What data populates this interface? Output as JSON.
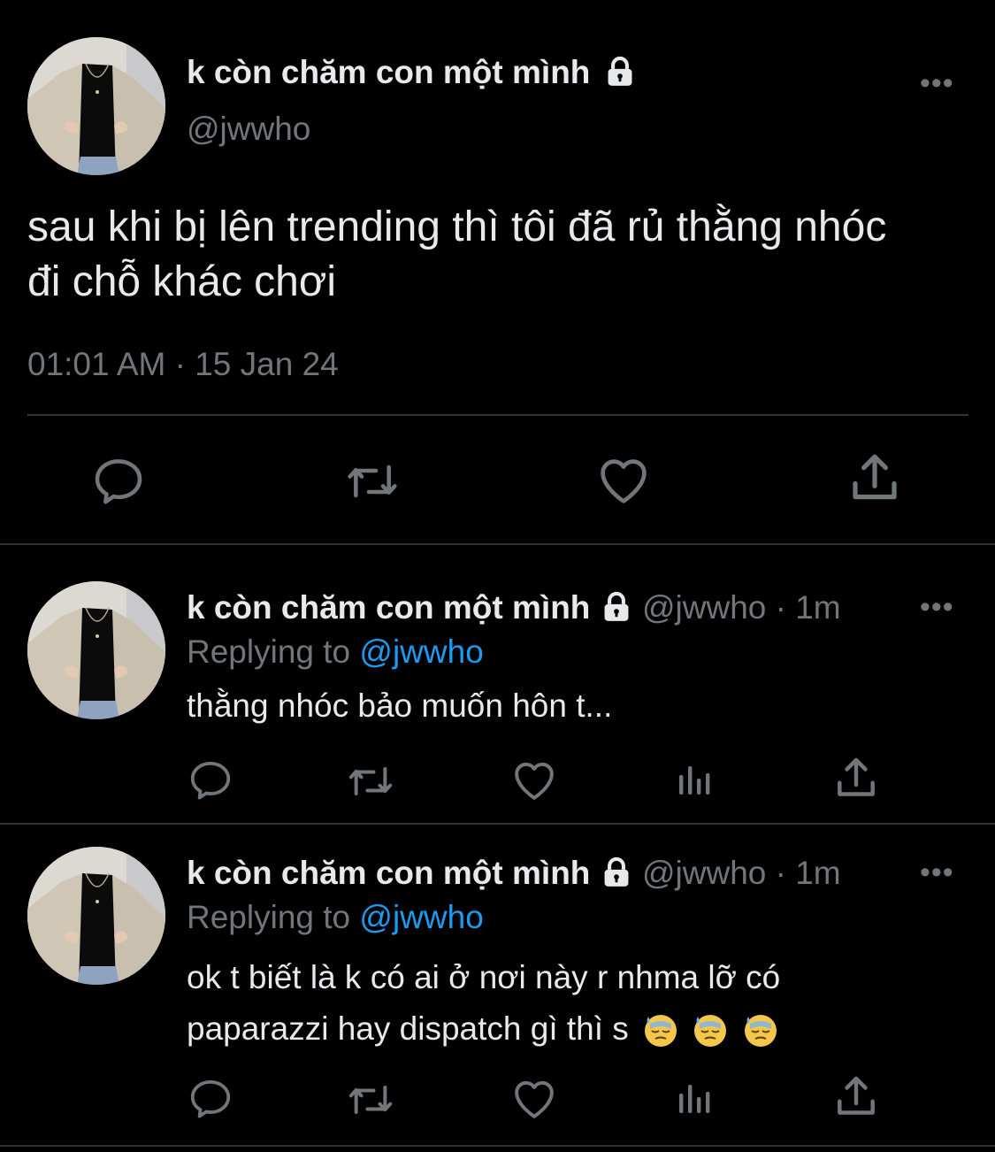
{
  "main_tweet": {
    "display_name": "k còn chăm con một mình",
    "handle": "@jwwho",
    "text_line1": "sau khi bị lên trending thì tôi đã rủ thằng nhóc",
    "text_line2": "đi chỗ khác chơi",
    "timestamp": "01:01 AM · 15 Jan 24",
    "more_label": "•••",
    "actions": [
      "reply-icon",
      "retweet-icon",
      "like-icon",
      "share-icon"
    ]
  },
  "replies": [
    {
      "display_name": "k còn chăm con một mình",
      "handle_time": "@jwwho · 1m",
      "replying_prefix": "Replying to",
      "replying_handle": "@jwwho",
      "text_line1": "thằng nhóc bảo muốn hôn t...",
      "more_label": "•••",
      "actions": [
        "reply-icon",
        "retweet-icon",
        "like-icon",
        "analytics-icon",
        "share-icon"
      ]
    },
    {
      "display_name": "k còn chăm con một mình",
      "handle_time": "@jwwho · 1m",
      "replying_prefix": "Replying to",
      "replying_handle": "@jwwho",
      "text_line1": "ok t biết là k có ai ở nơi này r nhma lỡ có",
      "text_line2": "paparazzi hay dispatch gì thì s",
      "emojis": [
        "downcast-face-with-sweat",
        "downcast-face-with-sweat",
        "downcast-face-with-sweat"
      ],
      "more_label": "•••",
      "actions": [
        "reply-icon",
        "retweet-icon",
        "like-icon",
        "analytics-icon",
        "share-icon"
      ]
    }
  ],
  "colors": {
    "background": "#000000",
    "text": "#e7e9ea",
    "muted": "#71767b",
    "link": "#1d9bf0",
    "divider": "#2f3336"
  }
}
